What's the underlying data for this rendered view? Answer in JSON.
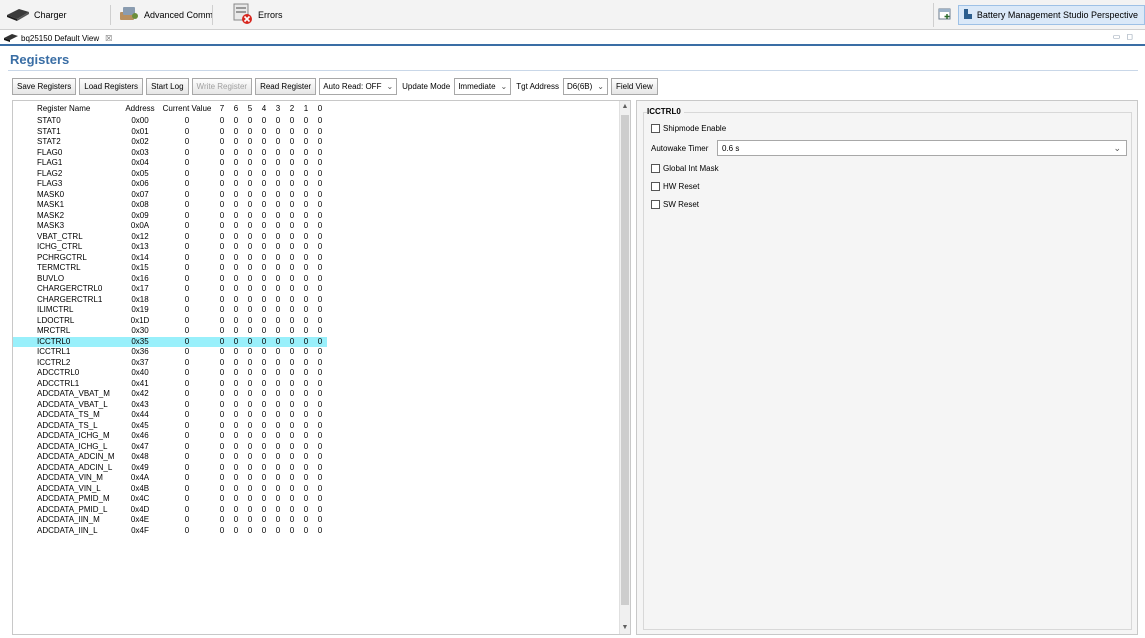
{
  "perspective_tabs": [
    {
      "label": "Charger",
      "icon": "charger-icon"
    },
    {
      "label": "Advanced Comm",
      "icon": "advanced-comm-icon"
    },
    {
      "label": "Errors",
      "icon": "errors-icon"
    }
  ],
  "perspective_name": "Battery Management Studio Perspective",
  "editor_tab": {
    "label": "bq25150 Default View",
    "close_glyph": "☒"
  },
  "page_title": "Registers",
  "toolbar": {
    "save_registers": "Save Registers",
    "load_registers": "Load Registers",
    "start_log": "Start Log",
    "write_register": "Write Register",
    "read_register": "Read Register",
    "auto_read": "Auto Read: OFF",
    "update_mode_label": "Update Mode",
    "update_mode_value": "Immediate",
    "tgt_address_label": "Tgt Address",
    "tgt_address_value": "D6(6B)",
    "field_view": "Field View"
  },
  "table": {
    "headers": [
      "Register Name",
      "Address",
      "Current Value",
      "7",
      "6",
      "5",
      "4",
      "3",
      "2",
      "1",
      "0"
    ],
    "selected_index": 23,
    "rows": [
      [
        "STAT0",
        "0x00",
        "0",
        "0",
        "0",
        "0",
        "0",
        "0",
        "0",
        "0",
        "0"
      ],
      [
        "STAT1",
        "0x01",
        "0",
        "0",
        "0",
        "0",
        "0",
        "0",
        "0",
        "0",
        "0"
      ],
      [
        "STAT2",
        "0x02",
        "0",
        "0",
        "0",
        "0",
        "0",
        "0",
        "0",
        "0",
        "0"
      ],
      [
        "FLAG0",
        "0x03",
        "0",
        "0",
        "0",
        "0",
        "0",
        "0",
        "0",
        "0",
        "0"
      ],
      [
        "FLAG1",
        "0x04",
        "0",
        "0",
        "0",
        "0",
        "0",
        "0",
        "0",
        "0",
        "0"
      ],
      [
        "FLAG2",
        "0x05",
        "0",
        "0",
        "0",
        "0",
        "0",
        "0",
        "0",
        "0",
        "0"
      ],
      [
        "FLAG3",
        "0x06",
        "0",
        "0",
        "0",
        "0",
        "0",
        "0",
        "0",
        "0",
        "0"
      ],
      [
        "MASK0",
        "0x07",
        "0",
        "0",
        "0",
        "0",
        "0",
        "0",
        "0",
        "0",
        "0"
      ],
      [
        "MASK1",
        "0x08",
        "0",
        "0",
        "0",
        "0",
        "0",
        "0",
        "0",
        "0",
        "0"
      ],
      [
        "MASK2",
        "0x09",
        "0",
        "0",
        "0",
        "0",
        "0",
        "0",
        "0",
        "0",
        "0"
      ],
      [
        "MASK3",
        "0x0A",
        "0",
        "0",
        "0",
        "0",
        "0",
        "0",
        "0",
        "0",
        "0"
      ],
      [
        "VBAT_CTRL",
        "0x12",
        "0",
        "0",
        "0",
        "0",
        "0",
        "0",
        "0",
        "0",
        "0"
      ],
      [
        "ICHG_CTRL",
        "0x13",
        "0",
        "0",
        "0",
        "0",
        "0",
        "0",
        "0",
        "0",
        "0"
      ],
      [
        "PCHRGCTRL",
        "0x14",
        "0",
        "0",
        "0",
        "0",
        "0",
        "0",
        "0",
        "0",
        "0"
      ],
      [
        "TERMCTRL",
        "0x15",
        "0",
        "0",
        "0",
        "0",
        "0",
        "0",
        "0",
        "0",
        "0"
      ],
      [
        "BUVLO",
        "0x16",
        "0",
        "0",
        "0",
        "0",
        "0",
        "0",
        "0",
        "0",
        "0"
      ],
      [
        "CHARGERCTRL0",
        "0x17",
        "0",
        "0",
        "0",
        "0",
        "0",
        "0",
        "0",
        "0",
        "0"
      ],
      [
        "CHARGERCTRL1",
        "0x18",
        "0",
        "0",
        "0",
        "0",
        "0",
        "0",
        "0",
        "0",
        "0"
      ],
      [
        "ILIMCTRL",
        "0x19",
        "0",
        "0",
        "0",
        "0",
        "0",
        "0",
        "0",
        "0",
        "0"
      ],
      [
        "LDOCTRL",
        "0x1D",
        "0",
        "0",
        "0",
        "0",
        "0",
        "0",
        "0",
        "0",
        "0"
      ],
      [
        "MRCTRL",
        "0x30",
        "0",
        "0",
        "0",
        "0",
        "0",
        "0",
        "0",
        "0",
        "0"
      ],
      [
        "ICCTRL0",
        "0x35",
        "0",
        "0",
        "0",
        "0",
        "0",
        "0",
        "0",
        "0",
        "0"
      ],
      [
        "ICCTRL1",
        "0x36",
        "0",
        "0",
        "0",
        "0",
        "0",
        "0",
        "0",
        "0",
        "0"
      ],
      [
        "ICCTRL2",
        "0x37",
        "0",
        "0",
        "0",
        "0",
        "0",
        "0",
        "0",
        "0",
        "0"
      ],
      [
        "ADCCTRL0",
        "0x40",
        "0",
        "0",
        "0",
        "0",
        "0",
        "0",
        "0",
        "0",
        "0"
      ],
      [
        "ADCCTRL1",
        "0x41",
        "0",
        "0",
        "0",
        "0",
        "0",
        "0",
        "0",
        "0",
        "0"
      ],
      [
        "ADCDATA_VBAT_M",
        "0x42",
        "0",
        "0",
        "0",
        "0",
        "0",
        "0",
        "0",
        "0",
        "0"
      ],
      [
        "ADCDATA_VBAT_L",
        "0x43",
        "0",
        "0",
        "0",
        "0",
        "0",
        "0",
        "0",
        "0",
        "0"
      ],
      [
        "ADCDATA_TS_M",
        "0x44",
        "0",
        "0",
        "0",
        "0",
        "0",
        "0",
        "0",
        "0",
        "0"
      ],
      [
        "ADCDATA_TS_L",
        "0x45",
        "0",
        "0",
        "0",
        "0",
        "0",
        "0",
        "0",
        "0",
        "0"
      ],
      [
        "ADCDATA_ICHG_M",
        "0x46",
        "0",
        "0",
        "0",
        "0",
        "0",
        "0",
        "0",
        "0",
        "0"
      ],
      [
        "ADCDATA_ICHG_L",
        "0x47",
        "0",
        "0",
        "0",
        "0",
        "0",
        "0",
        "0",
        "0",
        "0"
      ],
      [
        "ADCDATA_ADCIN_M",
        "0x48",
        "0",
        "0",
        "0",
        "0",
        "0",
        "0",
        "0",
        "0",
        "0"
      ],
      [
        "ADCDATA_ADCIN_L",
        "0x49",
        "0",
        "0",
        "0",
        "0",
        "0",
        "0",
        "0",
        "0",
        "0"
      ],
      [
        "ADCDATA_VIN_M",
        "0x4A",
        "0",
        "0",
        "0",
        "0",
        "0",
        "0",
        "0",
        "0",
        "0"
      ],
      [
        "ADCDATA_VIN_L",
        "0x4B",
        "0",
        "0",
        "0",
        "0",
        "0",
        "0",
        "0",
        "0",
        "0"
      ],
      [
        "ADCDATA_PMID_M",
        "0x4C",
        "0",
        "0",
        "0",
        "0",
        "0",
        "0",
        "0",
        "0",
        "0"
      ],
      [
        "ADCDATA_PMID_L",
        "0x4D",
        "0",
        "0",
        "0",
        "0",
        "0",
        "0",
        "0",
        "0",
        "0"
      ],
      [
        "ADCDATA_IIN_M",
        "0x4E",
        "0",
        "0",
        "0",
        "0",
        "0",
        "0",
        "0",
        "0",
        "0"
      ],
      [
        "ADCDATA_IIN_L",
        "0x4F",
        "0",
        "0",
        "0",
        "0",
        "0",
        "0",
        "0",
        "0",
        "0"
      ]
    ]
  },
  "field_view": {
    "title": "ICCTRL0",
    "shipmode_enable": "Shipmode Enable",
    "autowake_timer_label": "Autowake Timer",
    "autowake_timer_value": "0.6 s",
    "global_int_mask": "Global Int Mask",
    "hw_reset": "HW Reset",
    "sw_reset": "SW Reset"
  }
}
